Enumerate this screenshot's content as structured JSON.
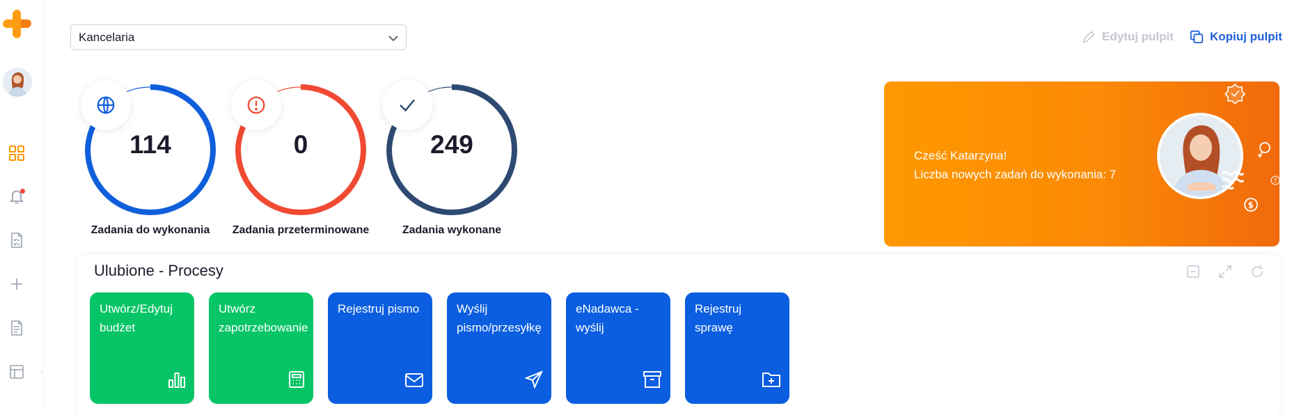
{
  "sidebar": {
    "logo": "plus-logo-icon",
    "avatar": "user-avatar",
    "items": [
      {
        "name": "dashboard-icon",
        "active": true
      },
      {
        "name": "bell-icon",
        "badge": true
      },
      {
        "name": "tasks-icon"
      },
      {
        "name": "plus-icon"
      },
      {
        "name": "document-icon"
      },
      {
        "name": "layout-icon"
      }
    ]
  },
  "header": {
    "select_value": "Kancelaria",
    "edit_label": "Edytuj pulpit",
    "copy_label": "Kopiuj pulpit"
  },
  "stats": [
    {
      "value": "114",
      "label": "Zadania do wykonania",
      "color": "#0f5fdc",
      "icon": "globe-icon",
      "fraction": 0.97
    },
    {
      "value": "0",
      "label": "Zadania przeterminowane",
      "color": "#f04a33",
      "icon": "alert-icon",
      "fraction": 0.97
    },
    {
      "value": "249",
      "label": "Zadania wykonane",
      "color": "#2e4a72",
      "icon": "check-icon",
      "fraction": 0.97
    }
  ],
  "greeting": {
    "line1": "Cześć Katarzyna!",
    "line2": "Liczba nowych zadań do wykonania: 7",
    "colors": {
      "start": "#ff9800",
      "end": "#f06a0c"
    }
  },
  "favorites": {
    "title": "Ulubione - Procesy",
    "tiles": [
      {
        "label": "Utwórz/Edytuj budżet",
        "color": "green",
        "icon": "bar-chart-icon"
      },
      {
        "label": "Utwórz zapotrzebowanie",
        "color": "green",
        "icon": "calculator-icon"
      },
      {
        "label": "Rejestruj pismo",
        "color": "blue",
        "icon": "mail-icon"
      },
      {
        "label": "Wyślij pismo/przesyłkę",
        "color": "blue",
        "icon": "send-icon"
      },
      {
        "label": "eNadawca - wyślij",
        "color": "blue",
        "icon": "archive-icon"
      },
      {
        "label": "Rejestruj sprawę",
        "color": "blue",
        "icon": "folder-plus-icon"
      }
    ]
  },
  "accent_colors": {
    "blue": "#0b5ee0",
    "green": "#07c566",
    "orange": "#ff9800",
    "red": "#f04a33"
  }
}
